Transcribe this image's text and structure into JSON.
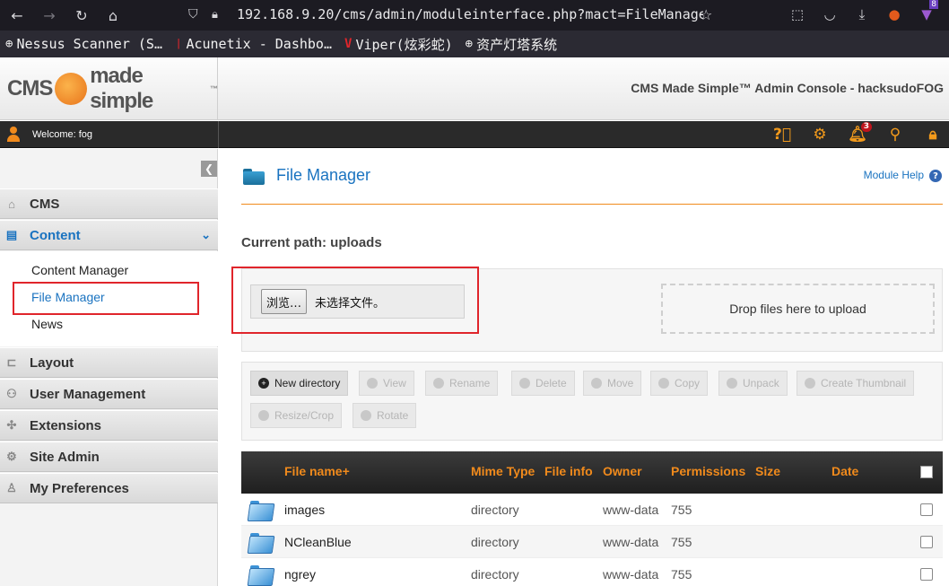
{
  "browser": {
    "url": "192.168.9.20/cms/admin/moduleinterface.php?mact=FileManager",
    "bookmarks": [
      {
        "label": "Nessus Scanner (S…",
        "icon": "globe-icon"
      },
      {
        "label": "Acunetix - Dashbo…",
        "icon": "acunetix-icon"
      },
      {
        "label": "Viper(炫彩蛇)",
        "icon": "viper-icon"
      },
      {
        "label": "资产灯塔系统",
        "icon": "globe-icon"
      }
    ],
    "extension_badge": "8"
  },
  "header": {
    "logo_text_left": "CMS",
    "logo_text_right": "made simple",
    "logo_tm": "™",
    "console_title": "CMS Made Simple™ Admin Console - hacksudoFOG"
  },
  "toolbar": {
    "welcome": "Welcome: fog",
    "notification_count": "3"
  },
  "sidebar": {
    "collapse_glyph": "❮",
    "items": [
      {
        "label": "CMS",
        "icon": "home-icon"
      },
      {
        "label": "Content",
        "icon": "content-icon"
      },
      {
        "label": "Layout",
        "icon": "layout-icon"
      },
      {
        "label": "User Management",
        "icon": "users-icon"
      },
      {
        "label": "Extensions",
        "icon": "puzzle-icon"
      },
      {
        "label": "Site Admin",
        "icon": "gear-icon"
      },
      {
        "label": "My Preferences",
        "icon": "user-icon"
      }
    ],
    "content_subitems": [
      "Content Manager",
      "File Manager",
      "News"
    ]
  },
  "main": {
    "title": "File Manager",
    "module_help": "Module Help",
    "help_glyph": "?",
    "current_path": "Current path: uploads",
    "browse_button": "浏览…",
    "no_file_selected": "未选择文件。",
    "drop_zone": "Drop files here to upload",
    "actions_row1": [
      "New directory",
      "View",
      "Rename",
      "Delete",
      "Move",
      "Copy",
      "Unpack",
      "Create Thumbnail"
    ],
    "actions_row2": [
      "Resize/Crop",
      "Rotate"
    ],
    "table_headers": [
      "File name+",
      "Mime Type",
      "File info",
      "Owner",
      "Permissions",
      "Size",
      "Date"
    ],
    "rows": [
      {
        "name": "images",
        "mime": "directory",
        "owner": "www-data",
        "perms": "755"
      },
      {
        "name": "NCleanBlue",
        "mime": "directory",
        "owner": "www-data",
        "perms": "755"
      },
      {
        "name": "ngrey",
        "mime": "directory",
        "owner": "www-data",
        "perms": "755"
      }
    ]
  },
  "colors": {
    "accent_orange": "#f08a1c",
    "link_blue": "#1a73c0",
    "highlight_red": "#e0252b"
  }
}
